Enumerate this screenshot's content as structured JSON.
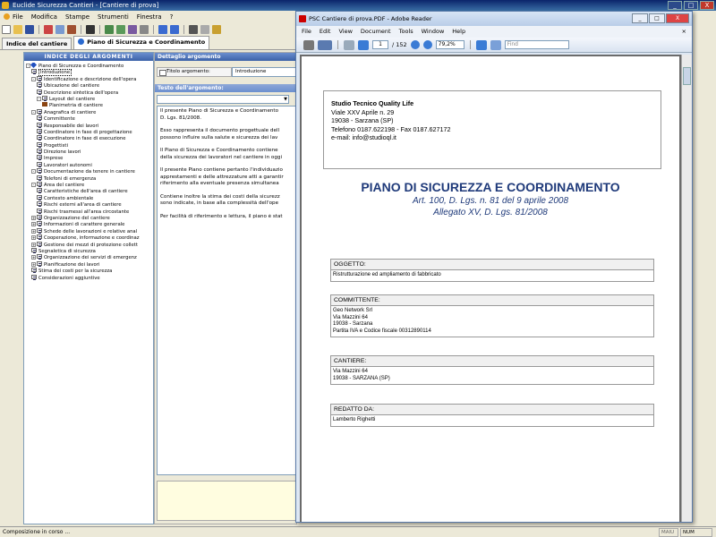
{
  "main_window": {
    "title": "Euclide Sicurezza Cantieri - [Cantiere di prova]",
    "controls": [
      "_",
      "□",
      "X"
    ]
  },
  "menu": [
    "File",
    "Modifica",
    "Stampe",
    "Strumenti",
    "Finestra",
    "?"
  ],
  "tabs": [
    {
      "label": "Indice del cantiere",
      "active": false
    },
    {
      "label": "Piano di Sicurezza e Coordinamento",
      "active": true
    }
  ],
  "left_panel": {
    "header": "INDICE DEGLI ARGOMENTI",
    "tree": [
      {
        "label": "Piano di Sicurezza e Coordinamento",
        "level": 0,
        "kind": "root",
        "exp": "-"
      },
      {
        "label": "Introduzione",
        "level": 1,
        "kind": "doc",
        "selected": true
      },
      {
        "label": "Identificazione e descrizione dell'opera",
        "level": 1,
        "kind": "doc",
        "exp": "-"
      },
      {
        "label": "Ubicazione del cantiere",
        "level": 2,
        "kind": "doc"
      },
      {
        "label": "Descrizione sintetica dell'opera",
        "level": 2,
        "kind": "doc"
      },
      {
        "label": "Layout del cantiere",
        "level": 2,
        "kind": "doc",
        "exp": "-"
      },
      {
        "label": "Planimetria di cantiere",
        "level": 3,
        "kind": "book"
      },
      {
        "label": "Anagrafica di cantiere",
        "level": 1,
        "kind": "doc",
        "exp": "-"
      },
      {
        "label": "Committente",
        "level": 2,
        "kind": "doc"
      },
      {
        "label": "Responsabile dei lavori",
        "level": 2,
        "kind": "doc"
      },
      {
        "label": "Coordinatore in fase di progettazione",
        "level": 2,
        "kind": "doc"
      },
      {
        "label": "Coordinatore in fase di esecuzione",
        "level": 2,
        "kind": "doc"
      },
      {
        "label": "Progettisti",
        "level": 2,
        "kind": "doc"
      },
      {
        "label": "Direzione lavori",
        "level": 2,
        "kind": "doc"
      },
      {
        "label": "Imprese",
        "level": 2,
        "kind": "doc"
      },
      {
        "label": "Lavoratori autonomi",
        "level": 2,
        "kind": "doc"
      },
      {
        "label": "Documentazione da tenere in cantiere",
        "level": 1,
        "kind": "doc",
        "exp": "-"
      },
      {
        "label": "Telefoni di emergenza",
        "level": 2,
        "kind": "doc"
      },
      {
        "label": "Area del cantiere",
        "level": 1,
        "kind": "doc",
        "exp": "-"
      },
      {
        "label": "Caratteristiche dell'area di cantiere",
        "level": 2,
        "kind": "doc"
      },
      {
        "label": "Contesto ambientale",
        "level": 2,
        "kind": "doc"
      },
      {
        "label": "Rischi esterni all'area di cantiere",
        "level": 2,
        "kind": "doc"
      },
      {
        "label": "Rischi trasmessi all'area circostante",
        "level": 2,
        "kind": "doc"
      },
      {
        "label": "Organizzazione del cantiere",
        "level": 1,
        "kind": "doc",
        "exp": "+"
      },
      {
        "label": "Informazioni di carattere generale",
        "level": 1,
        "kind": "doc",
        "exp": "+"
      },
      {
        "label": "Schede delle lavorazioni e relative anal",
        "level": 1,
        "kind": "doc",
        "exp": "+"
      },
      {
        "label": "Cooperazione, informazione e coordinaz",
        "level": 1,
        "kind": "doc",
        "exp": "+"
      },
      {
        "label": "Gestione dei mezzi di protezione collett",
        "level": 1,
        "kind": "doc",
        "exp": "+"
      },
      {
        "label": "Segnaletica di sicurezza",
        "level": 1,
        "kind": "doc"
      },
      {
        "label": "Organizzazione dei servizi di emergenz",
        "level": 1,
        "kind": "doc",
        "exp": "+"
      },
      {
        "label": "Pianificazione dei lavori",
        "level": 1,
        "kind": "doc",
        "exp": "+"
      },
      {
        "label": "Stima dei costi per la sicurezza",
        "level": 1,
        "kind": "doc"
      },
      {
        "label": "Considerazioni aggiuntive",
        "level": 1,
        "kind": "doc"
      }
    ]
  },
  "mid_panel": {
    "header": "Dettaglio argomento",
    "title_label": "Titolo argomento:",
    "title_value": "Introduzione",
    "text_header": "Testo dell'argomento:",
    "paragraphs": [
      [
        "Il presente Piano di Sicurezza e Coordinamento",
        "D. Lgs. 81/2008."
      ],
      [
        "Esso rappresenta il documento progettuale dell",
        "possono influire sulla salute e sicurezza dei lav"
      ],
      [
        "Il Piano di Sicurezza e Coordinamento contiene",
        "della sicurezza dei lavoratori nel cantiere in oggi"
      ],
      [
        "Il presente Piano contiene pertanto l'individuazio",
        "apprestamenti e delle attrezzature atti a garantir",
        "riferimento alla eventuale presenza simultanea "
      ],
      [
        "Contiene inoltre la stima dei costi della sicurezz",
        "sono indicate, in base alla complessità dell'ope"
      ],
      [
        "Per facilità di riferimento e lettura, il piano è stat"
      ]
    ]
  },
  "status": {
    "text": "Composizione in corso ...",
    "maiu": "MAIU",
    "num": "NUM"
  },
  "pdf_window": {
    "title": "PSC Cantiere di prova.PDF - Adobe Reader",
    "menu": [
      "File",
      "Edit",
      "View",
      "Document",
      "Tools",
      "Window",
      "Help"
    ],
    "page_current": "1",
    "page_total": "/ 152",
    "zoom": "79,2%",
    "find_placeholder": "Find",
    "doc": {
      "firm": "Studio Tecnico Quality Life",
      "address": [
        "Viale XXV Aprile n. 29",
        "19038 - Sarzana (SP)",
        "Telefono 0187.622198 - Fax 0187.627172",
        "e-mail: info@studioql.it"
      ],
      "title": "PIANO DI SICUREZZA E COORDINAMENTO",
      "subtitle1": "Art. 100, D. Lgs. n. 81 del 9 aprile 2008",
      "subtitle2": "Allegato XV, D. Lgs. 81/2008",
      "sections": [
        {
          "head": "OGGETTO:",
          "lines": [
            "Ristrutturazione ed ampliamento di fabbricato"
          ]
        },
        {
          "head": "COMMITTENTE:",
          "lines": [
            "Geo Network Srl",
            "Via Mazzini 64",
            "19038 - Sarzana",
            "Partita IVA e Codice fiscale 00312890114"
          ]
        },
        {
          "head": "CANTIERE:",
          "lines": [
            "Via Mazzini 64",
            "19038 - SARZANA (SP)"
          ]
        },
        {
          "head": "REDATTO DA:",
          "lines": [
            "Lamberto Righetti"
          ]
        }
      ]
    }
  }
}
